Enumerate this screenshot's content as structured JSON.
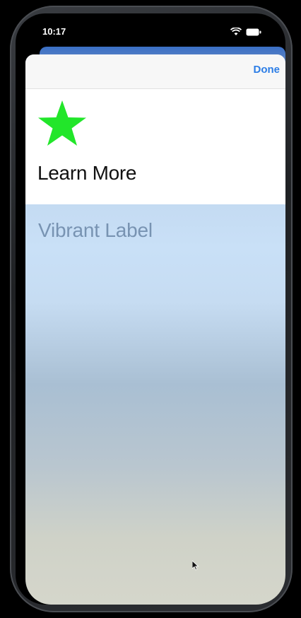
{
  "status_bar": {
    "time": "10:17"
  },
  "nav": {
    "done_label": "Done"
  },
  "header": {
    "title": "Learn More"
  },
  "body": {
    "vibrant_label": "Vibrant Label"
  },
  "icons": {
    "star": "star-icon",
    "wifi": "wifi-icon",
    "battery": "battery-icon",
    "cursor": "cursor-icon"
  },
  "colors": {
    "star": "#22e62a",
    "accent": "#2b7de6",
    "vibrant_text": "#7893b2"
  }
}
